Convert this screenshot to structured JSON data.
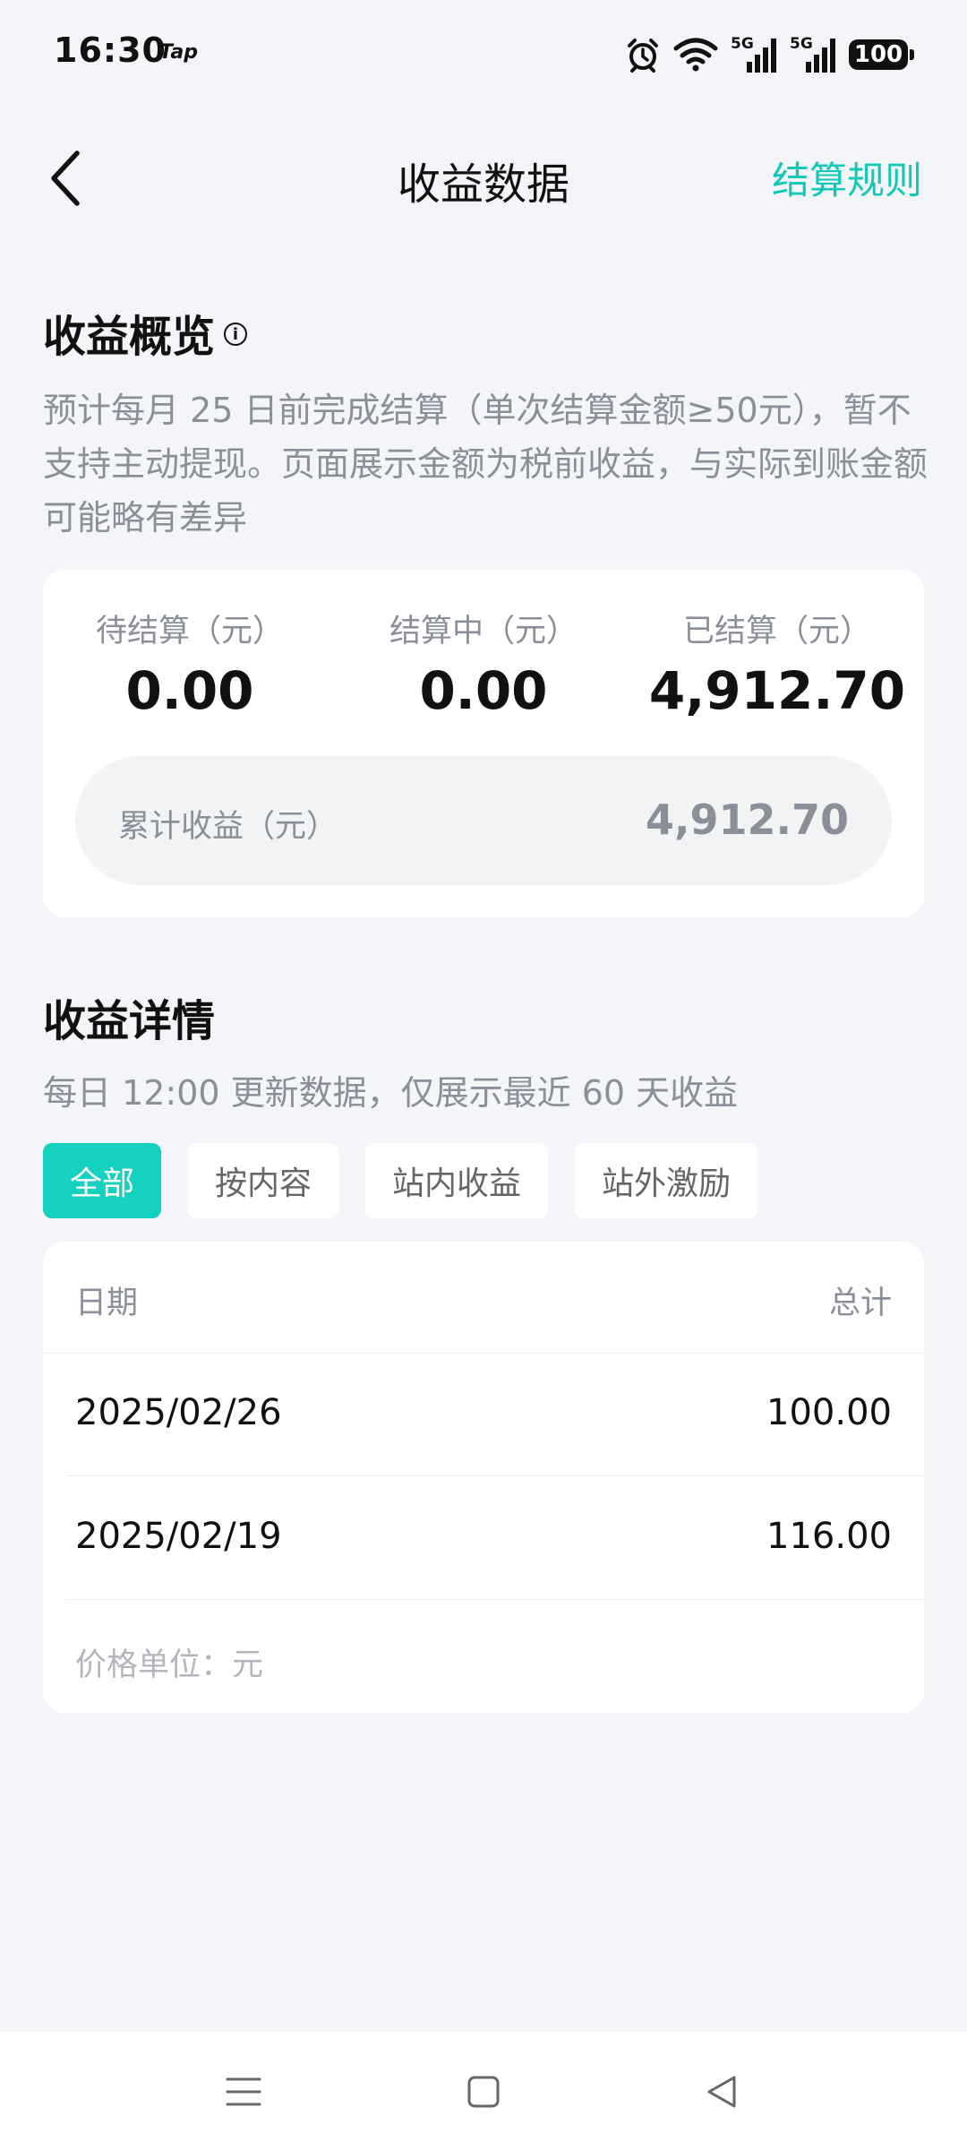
{
  "status_bar": {
    "time": "16:30",
    "carrier_tag": "Tap",
    "signal_1_tag": "5G",
    "signal_2_tag": "5G",
    "battery": "100"
  },
  "nav": {
    "title": "收益数据",
    "action": "结算规则"
  },
  "overview": {
    "title": "收益概览",
    "info_glyph": "i",
    "description": "预计每月 25 日前完成结算（单次结算金额≥50元），暂不支持主动提现。页面展示金额为税前收益，与实际到账金额可能略有差异",
    "stats": [
      {
        "label": "待结算（元）",
        "value": "0.00"
      },
      {
        "label": "结算中（元）",
        "value": "0.00"
      },
      {
        "label": "已结算（元）",
        "value": "4,912.70"
      }
    ],
    "total_label": "累计收益（元）",
    "total_value": "4,912.70"
  },
  "details": {
    "title": "收益详情",
    "description": "每日 12:00 更新数据，仅展示最近 60 天收益",
    "filters": [
      "全部",
      "按内容",
      "站内收益",
      "站外激励"
    ],
    "table_header": {
      "left": "日期",
      "right": "总计"
    },
    "rows": [
      {
        "date": "2025/02/26",
        "total": "100.00"
      },
      {
        "date": "2025/02/19",
        "total": "116.00"
      }
    ],
    "unit_note": "价格单位：元"
  },
  "colors": {
    "accent": "#14c8b8",
    "chip_active": "#14d2bf",
    "background": "#f4f5f8",
    "muted_text": "#8a8f99"
  },
  "icons": {
    "back": "chevron-left-icon",
    "alarm": "alarm-icon",
    "wifi": "wifi-icon",
    "menu": "menu-icon",
    "home": "square-icon",
    "back_system": "triangle-left-icon"
  }
}
